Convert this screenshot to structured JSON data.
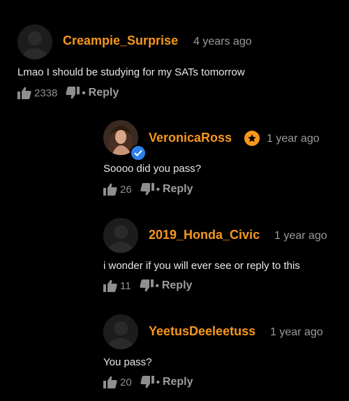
{
  "colors": {
    "background": "#000000",
    "username": "#f7971d",
    "muted": "#9a9a9a",
    "text": "#e8e8e8",
    "verified": "#2f80ed"
  },
  "comments": [
    {
      "username": "Creampie_Surprise",
      "time": "4 years ago",
      "text": "Lmao I should be studying for my SATs tomorrow",
      "likes": "2338",
      "reply": "Reply",
      "dot": "•",
      "avatar_icon": "default-avatar-icon"
    },
    {
      "username": "VeronicaRoss",
      "time": "1 year ago",
      "text": "Soooo did you pass?",
      "likes": "26",
      "reply": "Reply",
      "dot": "•",
      "avatar_icon": "user-photo-avatar",
      "badge_icon": "star-badge-icon",
      "verified_icon": "verified-check-icon"
    },
    {
      "username": "2019_Honda_Civic",
      "time": "1 year ago",
      "text": "i wonder if you will ever see or reply to this",
      "likes": "11",
      "reply": "Reply",
      "dot": "•",
      "avatar_icon": "default-avatar-icon"
    },
    {
      "username": "YeetusDeeleetuss",
      "time": "1 year ago",
      "text": "You pass?",
      "likes": "20",
      "reply": "Reply",
      "dot": "•",
      "avatar_icon": "default-avatar-icon"
    }
  ]
}
